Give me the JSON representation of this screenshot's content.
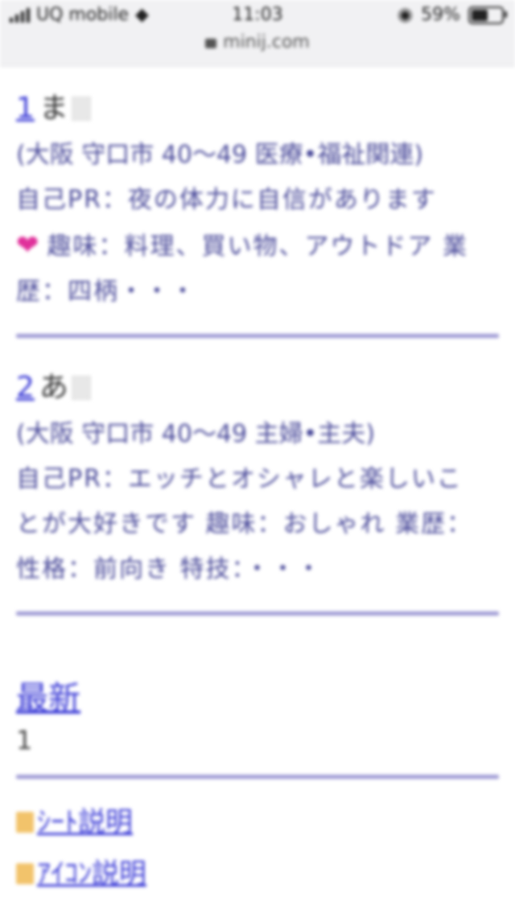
{
  "status": {
    "carrier": "UQ mobile",
    "time": "11:03",
    "battery": "59%",
    "battery_level": 0.59,
    "url": "minij.com"
  },
  "entries": [
    {
      "num": "1",
      "name": "ま",
      "meta": "(大阪 守口市 40〜49 医療•福祉関連)",
      "lines": [
        "自己PR：夜の体力に自信があります",
        "趣味：料理、買い物、アウトドア 業",
        "歴：四柄・・・"
      ]
    },
    {
      "num": "2",
      "name": "あ",
      "meta": "(大阪 守口市 40〜49 主婦•主夫)",
      "lines": [
        "自己PR：エッチとオシャレと楽しいこ",
        "とが大好きです 趣味：おしゃれ 業歴：",
        "性格：前向き 特技：・・・"
      ]
    }
  ],
  "newest": {
    "label": "最新",
    "count": "1"
  },
  "links": [
    "ｼｰﾄ説明",
    "ｱｲｺﾝ説明"
  ]
}
